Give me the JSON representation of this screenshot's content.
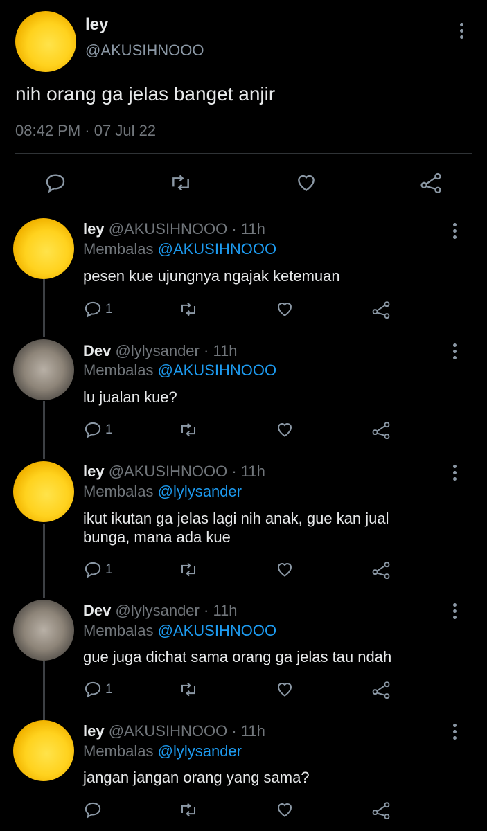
{
  "main_tweet": {
    "name": "ley",
    "handle": "@AKUSIHNOOO",
    "text": "nih orang ga jelas banget anjir",
    "time": "08:42 PM",
    "sep": "·",
    "date": "07 Jul 22"
  },
  "replies": [
    {
      "name": "ley",
      "handle": "@AKUSIHNOOO",
      "time": "· 11h",
      "reply_prefix": "Membalas",
      "reply_to": "@AKUSIHNOOO",
      "text": "pesen kue ujungnya ngajak ketemuan",
      "reply_count": "1",
      "avatar": "duck"
    },
    {
      "name": "Dev",
      "handle": "@lylysander",
      "time": "· 11h",
      "reply_prefix": "Membalas",
      "reply_to": "@AKUSIHNOOO",
      "text": "lu jualan kue?",
      "reply_count": "1",
      "avatar": "cat"
    },
    {
      "name": "ley",
      "handle": "@AKUSIHNOOO",
      "time": "· 11h",
      "reply_prefix": "Membalas",
      "reply_to": "@lylysander",
      "text_line1": "ikut ikutan ga jelas lagi nih anak, gue kan jual",
      "text_line2": "bunga, mana ada kue",
      "reply_count": "1",
      "avatar": "duck"
    },
    {
      "name": "Dev",
      "handle": "@lylysander",
      "time": "· 11h",
      "reply_prefix": "Membalas",
      "reply_to": "@AKUSIHNOOO",
      "text": "gue juga dichat sama orang ga jelas tau ndah",
      "reply_count": "1",
      "avatar": "cat"
    },
    {
      "name": "ley",
      "handle": "@AKUSIHNOOO",
      "time": "· 11h",
      "reply_prefix": "Membalas",
      "reply_to": "@lylysander",
      "text": "jangan jangan orang yang sama?",
      "reply_count": "",
      "avatar": "duck"
    }
  ],
  "icons": [
    "reply-icon",
    "retweet-icon",
    "like-icon",
    "share-icon",
    "more-icon"
  ],
  "colors": {
    "background": "#000000",
    "text": "#e7e9ea",
    "muted": "#71767b",
    "link": "#1d9bf0",
    "icon": "#8b98a5"
  }
}
